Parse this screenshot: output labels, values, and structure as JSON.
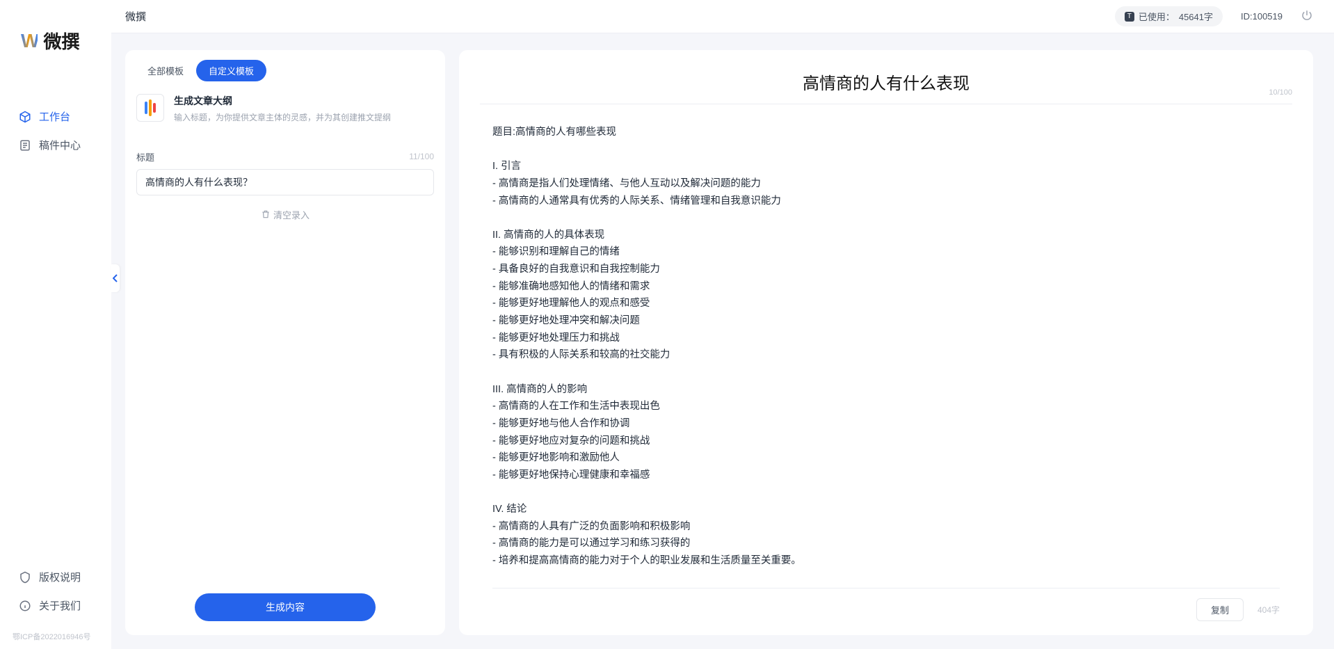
{
  "app": {
    "name": "微撰",
    "logo_text": "微撰"
  },
  "sidebar": {
    "items": [
      {
        "label": "工作台",
        "icon": "cube-icon",
        "active": true
      },
      {
        "label": "稿件中心",
        "icon": "doc-icon",
        "active": false
      }
    ],
    "bottom_items": [
      {
        "label": "版权说明",
        "icon": "shield-icon"
      },
      {
        "label": "关于我们",
        "icon": "info-icon"
      }
    ],
    "icp": "鄂ICP备2022016946号"
  },
  "topbar": {
    "title": "微撰",
    "usage_prefix": "已使用：",
    "usage_value": "45641字",
    "id_label": "ID:100519"
  },
  "left_panel": {
    "tabs": [
      {
        "label": "全部模板",
        "active": false
      },
      {
        "label": "自定义模板",
        "active": true
      }
    ],
    "template": {
      "title": "生成文章大纲",
      "desc": "输入标题，为你提供文章主体的灵感，并为其创建推文提纲"
    },
    "title_field": {
      "label": "标题",
      "value": "高情商的人有什么表现？",
      "counter": "11/100"
    },
    "clear_label": "清空录入",
    "generate_label": "生成内容"
  },
  "right_panel": {
    "title": "高情商的人有什么表现",
    "title_counter": "10/100",
    "body": "题目:高情商的人有哪些表现\n\nI. 引言\n- 高情商是指人们处理情绪、与他人互动以及解决问题的能力\n- 高情商的人通常具有优秀的人际关系、情绪管理和自我意识能力\n\nII. 高情商的人的具体表现\n- 能够识别和理解自己的情绪\n- 具备良好的自我意识和自我控制能力\n- 能够准确地感知他人的情绪和需求\n- 能够更好地理解他人的观点和感受\n- 能够更好地处理冲突和解决问题\n- 能够更好地处理压力和挑战\n- 具有积极的人际关系和较高的社交能力\n\nIII. 高情商的人的影响\n- 高情商的人在工作和生活中表现出色\n- 能够更好地与他人合作和协调\n- 能够更好地应对复杂的问题和挑战\n- 能够更好地影响和激励他人\n- 能够更好地保持心理健康和幸福感\n\nIV. 结论\n- 高情商的人具有广泛的负面影响和积极影响\n- 高情商的能力是可以通过学习和练习获得的\n- 培养和提高高情商的能力对于个人的职业发展和生活质量至关重要。",
    "copy_label": "复制",
    "word_count": "404字"
  }
}
